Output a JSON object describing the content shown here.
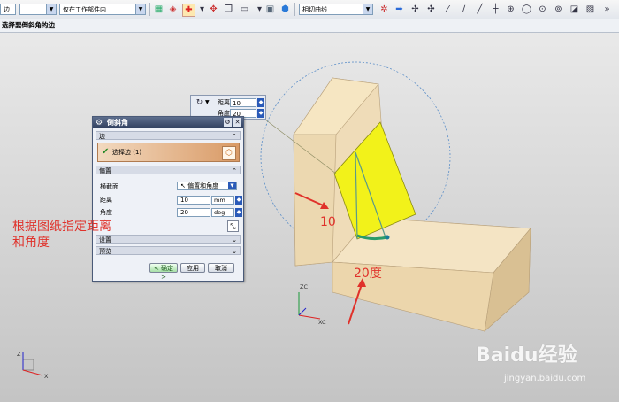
{
  "toolbar": {
    "filter_value": "边",
    "scope_value": "仅在工作部件内",
    "snap_value": "相切曲线"
  },
  "cue_line": "选择要倒斜角的边",
  "mini_box": {
    "distance_label": "距离",
    "distance_value": "10",
    "angle_label": "角度",
    "angle_value": "20"
  },
  "dialog": {
    "title": "倒斜角",
    "edge_section": "边",
    "select_edge": "选择边 (1)",
    "offset_section": "偏置",
    "cross_section_label": "横截面",
    "cross_section_value": "偏置和角度",
    "distance_label": "距离",
    "distance_value": "10",
    "distance_unit": "mm",
    "angle_label": "角度",
    "angle_value": "20",
    "angle_unit": "deg",
    "settings_section": "设置",
    "preview_section": "预览",
    "ok_button": "< 确定 >",
    "apply_button": "应用",
    "cancel_button": "取消"
  },
  "annotations": {
    "left_note_line1": "根据图纸指定距离",
    "left_note_line2": "和角度",
    "distance_mark": "10",
    "angle_mark": "20度"
  },
  "axes": {
    "zc": "ZC",
    "xc": "XC",
    "z": "Z",
    "x": "X"
  },
  "watermark": {
    "brand": "Baidu经验",
    "url": "jingyan.baidu.com"
  },
  "colors": {
    "part_face": "#efdcb8",
    "chamfer_face": "#f2f21a",
    "annotation_red": "#e0312a",
    "title_bar": "#3a4a6a"
  }
}
